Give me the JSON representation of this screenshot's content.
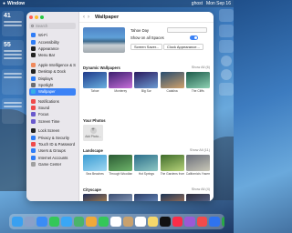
{
  "menubar": {
    "app_name": "Window",
    "right_items": [
      "ghost",
      "Mon Sep 16"
    ]
  },
  "widgets_left": {
    "temp1": "41",
    "temp2": "55"
  },
  "sidebar": {
    "search_placeholder": "Search",
    "items": [
      {
        "label": "Wi-Fi",
        "color": "#2f7df6"
      },
      {
        "label": "Accessibility",
        "color": "#2f7df6"
      },
      {
        "label": "Appearance",
        "color": "#222222"
      },
      {
        "label": "Menu Bar",
        "color": "#222222"
      },
      {
        "label": "Apple Intelligence & Siri",
        "color": "#f08a5d"
      },
      {
        "label": "Desktop & Dock",
        "color": "#222222"
      },
      {
        "label": "Displays",
        "color": "#2f7df6"
      },
      {
        "label": "Spotlight",
        "color": "#6b6b70"
      },
      {
        "label": "Wallpaper",
        "color": "#36b0e6"
      },
      {
        "label": "Notifications",
        "color": "#ef4b4b"
      },
      {
        "label": "Sound",
        "color": "#ef4b4b"
      },
      {
        "label": "Focus",
        "color": "#6a5acd"
      },
      {
        "label": "Screen Time",
        "color": "#6a5acd"
      },
      {
        "label": "Lock Screen",
        "color": "#222222"
      },
      {
        "label": "Privacy & Security",
        "color": "#2f7df6"
      },
      {
        "label": "Touch ID & Password",
        "color": "#ef4b4b"
      },
      {
        "label": "Users & Groups",
        "color": "#2f7df6"
      },
      {
        "label": "Internet Accounts",
        "color": "#2f7df6"
      },
      {
        "label": "Game Center",
        "color": "#a0a0a0"
      }
    ],
    "active_index": 8
  },
  "main": {
    "title": "Wallpaper",
    "current_name": "Tahoe Day",
    "show_all_spaces": "Show on all Spaces",
    "btn_screen_saver": "Screen Saver...",
    "btn_appearance": "Clock Appearance...",
    "sections": [
      {
        "title": "Dynamic Wallpapers",
        "show_all": "Show All (6)",
        "tiles": [
          {
            "label": "Tahoe",
            "colors": [
              "#1f3a8a",
              "#6ab0e0"
            ]
          },
          {
            "label": "Monterey",
            "colors": [
              "#3b1e6e",
              "#c66fd9"
            ]
          },
          {
            "label": "Big Sur",
            "colors": [
              "#2a1a5e",
              "#6c9bd2"
            ]
          },
          {
            "label": "Catalina",
            "colors": [
              "#274c6e",
              "#d1a26b"
            ]
          },
          {
            "label": "The Cliffs",
            "colors": [
              "#1c5a4a",
              "#8ed1b3"
            ]
          }
        ]
      },
      {
        "title": "Your Photos",
        "show_all": "",
        "tiles": [
          {
            "label": "Add Photo...",
            "add": true
          }
        ]
      },
      {
        "title": "Landscape",
        "show_all": "Show All (11)",
        "tiles": [
          {
            "label": "Sea Beaches",
            "colors": [
              "#3a9bd2",
              "#9fd8f2"
            ]
          },
          {
            "label": "Through Woodlands",
            "colors": [
              "#2a5a33",
              "#6eb36a"
            ]
          },
          {
            "label": "Hot Springs",
            "colors": [
              "#2b6e8a",
              "#8fc8c4"
            ]
          },
          {
            "label": "The Gardens from Above",
            "colors": [
              "#3e6b2a",
              "#b6d27a"
            ]
          },
          {
            "label": "California's Yosemite Valley",
            "colors": [
              "#6a6e7a",
              "#c9c8b8"
            ]
          }
        ]
      },
      {
        "title": "Cityscape",
        "show_all": "Show All (4)",
        "tiles": [
          {
            "label": "",
            "colors": [
              "#1e2d5a",
              "#e0a24a"
            ]
          },
          {
            "label": "",
            "colors": [
              "#3a4c70",
              "#a6b9d6"
            ]
          },
          {
            "label": "",
            "colors": [
              "#2c3e66",
              "#7aa2d8"
            ]
          },
          {
            "label": "",
            "colors": [
              "#1a3355",
              "#d08a5a"
            ]
          },
          {
            "label": "",
            "colors": [
              "#2b2b3b",
              "#6e7fa8"
            ]
          }
        ]
      }
    ]
  },
  "dock": {
    "apps": [
      "Finder",
      "Launchpad",
      "Safari",
      "Messages",
      "Mail",
      "Maps",
      "Photos",
      "FaceTime",
      "Calendar",
      "Contacts",
      "Reminders",
      "Notes",
      "TV",
      "Music",
      "Podcasts",
      "News",
      "Keynote",
      "Numbers",
      "Pages",
      "App Store",
      "System Settings",
      "Downloads",
      "Trash"
    ],
    "colors": [
      "#3aa0f0",
      "#8aa0c8",
      "#3b8cf5",
      "#34c759",
      "#3aa7f5",
      "#4bb46b",
      "#f0a93a",
      "#34c759",
      "#ffffff",
      "#c8a16e",
      "#ffffff",
      "#f6d86b",
      "#111111",
      "#fa2d48",
      "#9b59d6",
      "#f24b4b",
      "#2f73f0",
      "#29a745",
      "#f29b3a",
      "#2f7df6",
      "#8e8e93",
      "#5aa9f5",
      "#c8ced6"
    ]
  }
}
